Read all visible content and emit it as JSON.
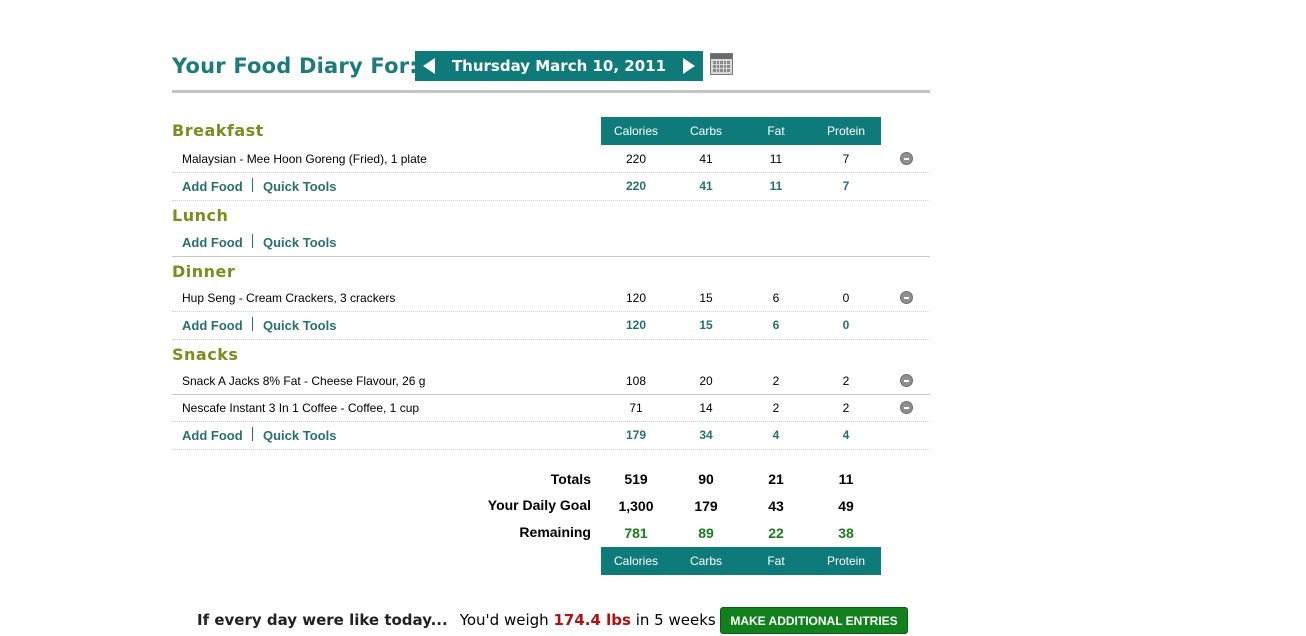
{
  "header": {
    "title": "Your Food Diary For:",
    "date": "Thursday March 10, 2011"
  },
  "columns": [
    "Calories",
    "Carbs",
    "Fat",
    "Protein"
  ],
  "meals": {
    "breakfast": {
      "title": "Breakfast",
      "foods": [
        {
          "name": "Malaysian - Mee Hoon Goreng (Fried), 1 plate",
          "calories": "220",
          "carbs": "41",
          "fat": "11",
          "protein": "7"
        }
      ],
      "totals": {
        "calories": "220",
        "carbs": "41",
        "fat": "11",
        "protein": "7"
      }
    },
    "lunch": {
      "title": "Lunch",
      "foods": [],
      "totals": {}
    },
    "dinner": {
      "title": "Dinner",
      "foods": [
        {
          "name": "Hup Seng - Cream Crackers, 3 crackers",
          "calories": "120",
          "carbs": "15",
          "fat": "6",
          "protein": "0"
        }
      ],
      "totals": {
        "calories": "120",
        "carbs": "15",
        "fat": "6",
        "protein": "0"
      }
    },
    "snacks": {
      "title": "Snacks",
      "foods": [
        {
          "name": "Snack A Jacks 8% Fat - Cheese Flavour, 26 g",
          "calories": "108",
          "carbs": "20",
          "fat": "2",
          "protein": "2"
        },
        {
          "name": "Nescafe Instant 3 In 1 Coffee - Coffee, 1 cup",
          "calories": "71",
          "carbs": "14",
          "fat": "2",
          "protein": "2"
        }
      ],
      "totals": {
        "calories": "179",
        "carbs": "34",
        "fat": "4",
        "protein": "4"
      }
    }
  },
  "links": {
    "add_food": "Add Food",
    "quick_tools": "Quick Tools"
  },
  "summary": {
    "totals": {
      "label": "Totals",
      "calories": "519",
      "carbs": "90",
      "fat": "21",
      "protein": "11"
    },
    "goal": {
      "label": "Your Daily Goal",
      "calories": "1,300",
      "carbs": "179",
      "fat": "43",
      "protein": "49"
    },
    "remaining": {
      "label": "Remaining",
      "calories": "781",
      "carbs": "89",
      "fat": "22",
      "protein": "38"
    }
  },
  "footer": {
    "lead": "If every day were like today...",
    "pre": "You'd weigh",
    "weight": "174.4 lbs",
    "post": "in 5 weeks",
    "button": "MAKE ADDITIONAL ENTRIES"
  },
  "colors": {
    "accent": "#0f7a7a",
    "meal_title": "#7f8b20",
    "remaining": "#1e7a1e",
    "weight": "#b01010",
    "button": "#12801c"
  },
  "icons": {
    "prev": "triangle-left-icon",
    "next": "triangle-right-icon",
    "calendar": "calendar-icon",
    "remove": "remove-circle-icon"
  }
}
